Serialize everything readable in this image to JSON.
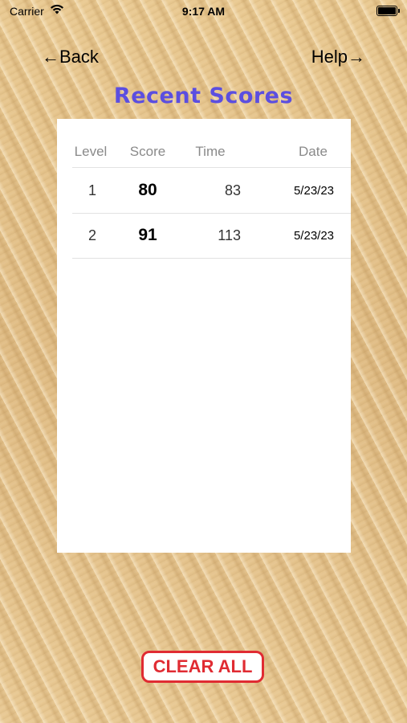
{
  "status_bar": {
    "carrier": "Carrier",
    "time": "9:17 AM"
  },
  "nav": {
    "back_label": "←Back",
    "help_label": "Help→"
  },
  "title": "Recent Scores",
  "table": {
    "headers": [
      "Level",
      "Score",
      "Time",
      "Date"
    ],
    "rows": [
      {
        "level": "1",
        "score": "80",
        "time": "83",
        "date": "5/23/23"
      },
      {
        "level": "2",
        "score": "91",
        "time": "113",
        "date": "5/23/23"
      }
    ]
  },
  "clear_button_label": "CLEAR ALL",
  "colors": {
    "title": "#5b4ee0",
    "clear_button": "#e02b32",
    "sand": "#e6c48e"
  }
}
